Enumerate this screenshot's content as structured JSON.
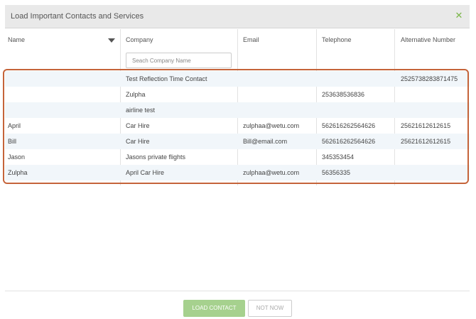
{
  "modal": {
    "title": "Load Important Contacts and Services",
    "close_icon": "close-icon",
    "close_symbol": "✕"
  },
  "table": {
    "columns": [
      "Name",
      "Company",
      "Email",
      "Telephone",
      "Alternative Number"
    ],
    "sort_icon": "sort-caret-down-icon",
    "search_placeholder": "Seach Company Name",
    "search_value": "",
    "rows": [
      [
        "",
        "Test Reflection Time Contact",
        "",
        "",
        "2525738283871475"
      ],
      [
        "",
        "Zulpha",
        "",
        "253638536836",
        ""
      ],
      [
        "",
        "airline test",
        "",
        "",
        ""
      ],
      [
        "April",
        "Car Hire",
        "zulphaa@wetu.com",
        "562616262564626",
        "25621612612615"
      ],
      [
        "Bill",
        "Car Hire",
        "Bill@email.com",
        "562616262564626",
        "25621612612615"
      ],
      [
        "Jason",
        "Jasons private flights",
        "",
        "345353454",
        ""
      ],
      [
        "Zulpha",
        "April Car Hire",
        "zulphaa@wetu.com",
        "56356335",
        ""
      ]
    ]
  },
  "footer": {
    "load_label": "LOAD CONTACT",
    "not_now_label": "NOT NOW"
  },
  "colors": {
    "accent_green": "#7ab648",
    "button_green": "#a6d18e",
    "highlight_border": "#c5643a",
    "row_alt": "#f1f6fa",
    "header_bg": "#e9e9e9"
  }
}
